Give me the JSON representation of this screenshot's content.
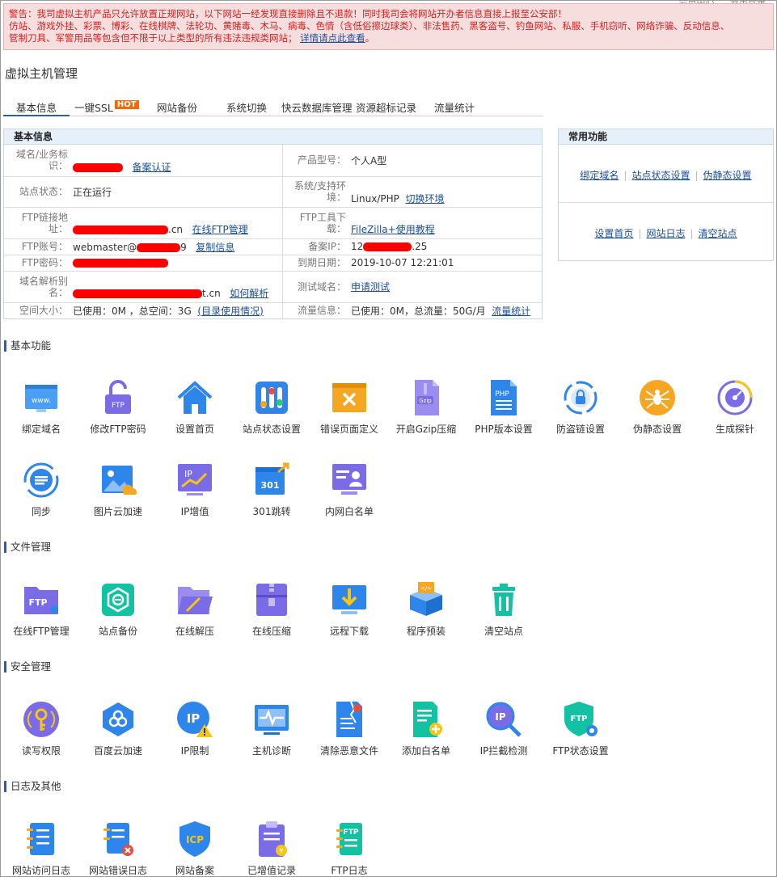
{
  "topbar": {
    "item1": "会员中心",
    "item2": "退出登录"
  },
  "warning": {
    "line1": "警告：我司虚拟主机产品只允许放置正规网站，以下网站一经发现直接删除且不退款！同时我司会将网站开办者信息直接上报至公安部！",
    "line2": "仿站、游戏外挂、彩票、博彩、在线棋牌、法轮功、黄赌毒、木马、病毒、色情（含低俗擦边球类）、非法售药、黑客盗号、钓鱼网站、私服、手机窃听、网络诈骗、反动信息、",
    "line3": "管制刀具、军警用品等包含但不限于以上类型的所有违法违规类网站；",
    "link": "详情请点此查看",
    "tail": "。"
  },
  "page_title": "虚拟主机管理",
  "tabs": [
    {
      "label": "基本信息"
    },
    {
      "label": "一键SSL",
      "badge": "HOT"
    },
    {
      "label": "网站备份"
    },
    {
      "label": "系统切换"
    },
    {
      "label": "快云数据库管理"
    },
    {
      "label": "资源超标记录"
    },
    {
      "label": "流量统计"
    }
  ],
  "info": {
    "title": "基本信息",
    "domain_label": "域名/业务标识：",
    "domain_link": "备案认证",
    "product_label": "产品型号：",
    "product_value": "个人A型",
    "status_label": "站点状态：",
    "status_value": "正在运行",
    "env_label": "系统/支持环境：",
    "env_value": "Linux/PHP",
    "env_link": "切换环境",
    "ftp_addr_label": "FTP链接地址：",
    "ftp_addr_suffix": ".cn",
    "ftp_addr_link": "在线FTP管理",
    "ftp_tool_label": "FTP工具下载：",
    "ftp_tool_link": "FileZilla+使用教程",
    "ftp_acc_label": "FTP账号：",
    "ftp_acc_prefix": "webmaster@",
    "ftp_acc_suffix": "9",
    "ftp_acc_link": "复制信息",
    "ip_label": "备案IP：",
    "ip_prefix": "12",
    "ip_suffix": ".25",
    "ftp_pwd_label": "FTP密码：",
    "expire_label": "到期日期：",
    "expire_value": "2019-10-07 12:21:01",
    "dns_label": "域名解析别名：",
    "dns_suffix": "t.cn",
    "dns_link": "如何解析",
    "test_label": "测试域名：",
    "test_link": "申请测试",
    "space_label": "空间大小：",
    "space_value": "已使用：0M ，总空间：3G",
    "space_link": "(目录使用情况)",
    "traffic_label": "流量信息：",
    "traffic_value": "已使用：0M，总流量：50G/月",
    "traffic_link": "流量统计"
  },
  "common": {
    "title": "常用功能",
    "row1": [
      "绑定域名",
      "站点状态设置",
      "伪静态设置"
    ],
    "row2": [
      "设置首页",
      "网站日志",
      "清空站点"
    ]
  },
  "sections": {
    "basic": {
      "title": "基本功能",
      "items": [
        {
          "label": "绑定域名",
          "icon": "browser-www-icon"
        },
        {
          "label": "修改FTP密码",
          "icon": "ftp-lock-icon"
        },
        {
          "label": "设置首页",
          "icon": "home-icon"
        },
        {
          "label": "站点状态设置",
          "icon": "status-toggle-icon"
        },
        {
          "label": "错误页面定义",
          "icon": "error-page-icon"
        },
        {
          "label": "开启Gzip压缩",
          "icon": "gzip-file-icon"
        },
        {
          "label": "PHP版本设置",
          "icon": "php-file-icon"
        },
        {
          "label": "防盗链设置",
          "icon": "anti-leech-icon"
        },
        {
          "label": "伪静态设置",
          "icon": "spider-icon"
        },
        {
          "label": "生成探针",
          "icon": "radar-probe-icon"
        },
        {
          "label": "同步",
          "icon": "sync-icon"
        },
        {
          "label": "图片云加速",
          "icon": "image-cloud-icon"
        },
        {
          "label": "IP增值",
          "icon": "ip-growth-icon",
          "text": "IP"
        },
        {
          "label": "301跳转",
          "icon": "redirect-301-icon",
          "text": "301"
        },
        {
          "label": "内网白名单",
          "icon": "intranet-whitelist-icon"
        }
      ]
    },
    "files": {
      "title": "文件管理",
      "items": [
        {
          "label": "在线FTP管理",
          "icon": "ftp-folder-icon",
          "text": "FTP"
        },
        {
          "label": "站点备份",
          "icon": "site-backup-icon"
        },
        {
          "label": "在线解压",
          "icon": "open-folder-icon"
        },
        {
          "label": "在线压缩",
          "icon": "zip-archive-icon"
        },
        {
          "label": "远程下载",
          "icon": "remote-download-icon"
        },
        {
          "label": "程序预装",
          "icon": "code-box-icon"
        },
        {
          "label": "清空站点",
          "icon": "trash-icon"
        }
      ]
    },
    "security": {
      "title": "安全管理",
      "items": [
        {
          "label": "读写权限",
          "icon": "key-permission-icon"
        },
        {
          "label": "百度云加速",
          "icon": "cloud-accel-icon"
        },
        {
          "label": "IP限制",
          "icon": "ip-restrict-icon",
          "text": "IP"
        },
        {
          "label": "主机诊断",
          "icon": "host-diagnose-icon"
        },
        {
          "label": "清除恶意文件",
          "icon": "malware-clean-icon"
        },
        {
          "label": "添加白名单",
          "icon": "add-whitelist-icon"
        },
        {
          "label": "IP拦截检测",
          "icon": "ip-search-icon",
          "text": "IP"
        },
        {
          "label": "FTP状态设置",
          "icon": "ftp-shield-icon",
          "text": "FTP"
        }
      ]
    },
    "logs": {
      "title": "日志及其他",
      "items": [
        {
          "label": "网站访问日志",
          "icon": "access-log-icon"
        },
        {
          "label": "网站错误日志",
          "icon": "error-log-icon"
        },
        {
          "label": "网站备案",
          "icon": "icp-shield-icon",
          "text": "ICP"
        },
        {
          "label": "已增值记录",
          "icon": "clipboard-record-icon"
        },
        {
          "label": "FTP日志",
          "icon": "ftp-log-icon",
          "text": "FTP"
        }
      ]
    }
  }
}
